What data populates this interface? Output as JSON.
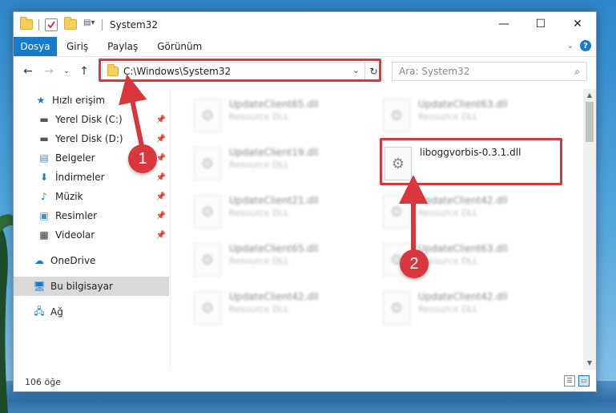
{
  "window": {
    "title": "System32",
    "controls": {
      "minimize": "—",
      "maximize": "☐",
      "close": "✕"
    }
  },
  "ribbon": {
    "tabs": [
      "Dosya",
      "Giriş",
      "Paylaş",
      "Görünüm"
    ]
  },
  "navigation": {
    "address_path": "C:\\Windows\\System32",
    "search_placeholder": "Ara: System32"
  },
  "sidebar": {
    "items": [
      {
        "label": "Hızlı erişim",
        "icon": "star-icon"
      },
      {
        "label": "Yerel Disk (C:)",
        "icon": "drive-icon",
        "pinned": true
      },
      {
        "label": "Yerel Disk (D:)",
        "icon": "drive-icon",
        "pinned": true
      },
      {
        "label": "Belgeler",
        "icon": "documents-icon",
        "pinned": true
      },
      {
        "label": "İndirmeler",
        "icon": "download-icon",
        "pinned": true
      },
      {
        "label": "Müzik",
        "icon": "music-icon",
        "pinned": true
      },
      {
        "label": "Resimler",
        "icon": "pictures-icon",
        "pinned": true
      },
      {
        "label": "Videolar",
        "icon": "video-icon",
        "pinned": true
      },
      {
        "label": "OneDrive",
        "icon": "cloud-icon"
      },
      {
        "label": "Bu bilgisayar",
        "icon": "computer-icon",
        "selected": true
      },
      {
        "label": "Ağ",
        "icon": "network-icon"
      }
    ]
  },
  "files": [
    {
      "name": "UpdateClient65.dll",
      "type": "Resource DLL",
      "blurred": true
    },
    {
      "name": "UpdateClient63.dll",
      "type": "Resource DLL",
      "blurred": true
    },
    {
      "name": "UpdateClient19.dll",
      "type": "Resource DLL",
      "blurred": true
    },
    {
      "name": "liboggvorbis-0.3.1.dll",
      "type": "",
      "blurred": false
    },
    {
      "name": "UpdateClient21.dll",
      "type": "Resource DLL",
      "blurred": true
    },
    {
      "name": "UpdateClient42.dll",
      "type": "Resource DLL",
      "blurred": true
    },
    {
      "name": "UpdateClient65.dll",
      "type": "Resource DLL",
      "blurred": true
    },
    {
      "name": "UpdateClient63.dll",
      "type": "Resource DLL",
      "blurred": true
    },
    {
      "name": "UpdateClient42.dll",
      "type": "Resource DLL",
      "blurred": true
    },
    {
      "name": "UpdateClient42.dll",
      "type": "Resource DLL",
      "blurred": true
    }
  ],
  "annotations": {
    "step1": "1",
    "step2": "2",
    "color": "#d9363e"
  },
  "status": {
    "item_count": "106 öğe"
  }
}
